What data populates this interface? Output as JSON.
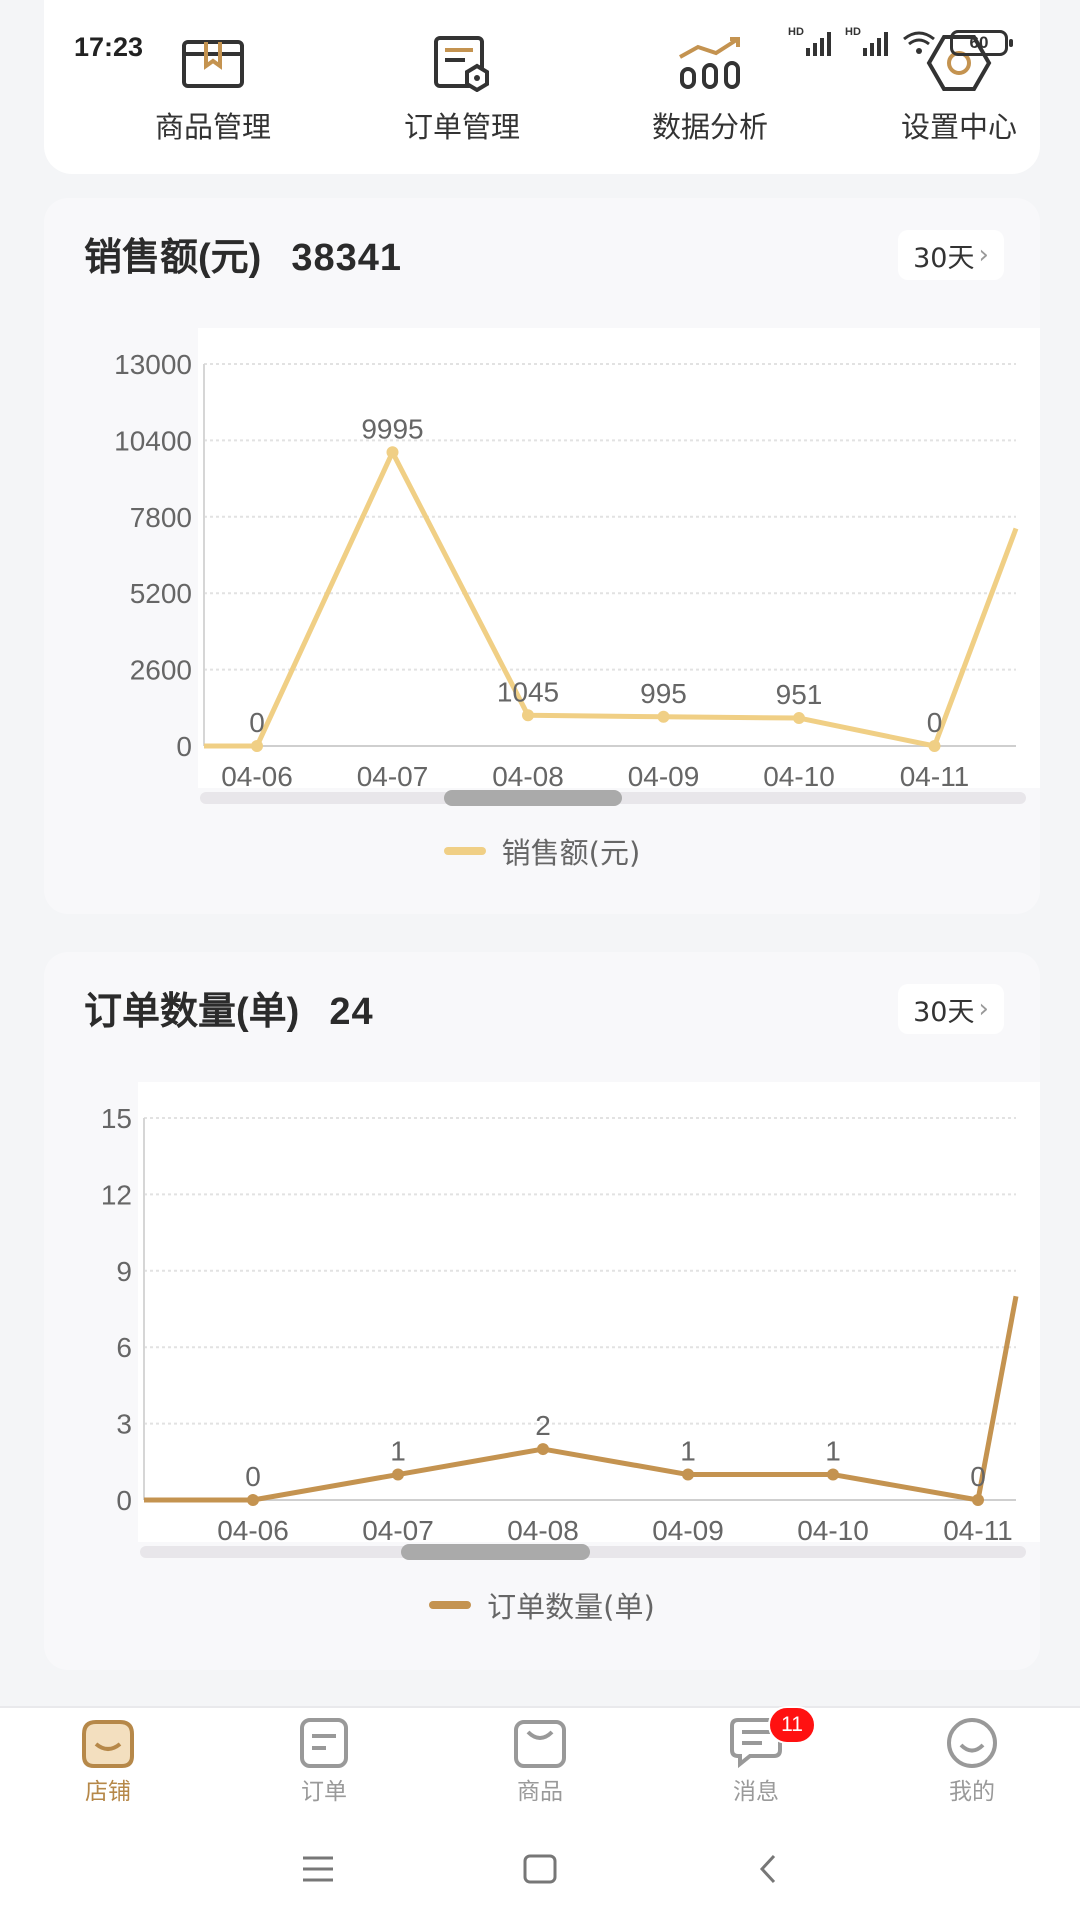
{
  "status": {
    "time": "17:23",
    "battery": "60"
  },
  "menu": [
    {
      "label": "商品管理",
      "icon": "product-box-icon"
    },
    {
      "label": "订单管理",
      "icon": "order-doc-icon"
    },
    {
      "label": "数据分析",
      "icon": "data-chart-icon"
    },
    {
      "label": "设置中心",
      "icon": "settings-gear-icon"
    }
  ],
  "sales": {
    "title": "销售额(元)",
    "total": "38341",
    "range": "30天",
    "legend": "销售额(元)",
    "color": "#f0cf85"
  },
  "orders": {
    "title": "订单数量(单)",
    "total": "24",
    "range": "30天",
    "legend": "订单数量(单)",
    "color": "#c49350"
  },
  "chart_data": [
    {
      "type": "line",
      "title": "销售额(元)",
      "categories": [
        "04-06",
        "04-07",
        "04-08",
        "04-09",
        "04-10",
        "04-11"
      ],
      "series": [
        {
          "name": "销售额(元)",
          "values": [
            0,
            9995,
            1045,
            995,
            951,
            0
          ]
        }
      ],
      "y_ticks": [
        0,
        2600,
        5200,
        7800,
        10400,
        13000
      ],
      "ylim": [
        0,
        13000
      ],
      "grid": true,
      "legend": "bottom-center"
    },
    {
      "type": "line",
      "title": "订单数量(单)",
      "categories": [
        "04-06",
        "04-07",
        "04-08",
        "04-09",
        "04-10",
        "04-11"
      ],
      "series": [
        {
          "name": "订单数量(单)",
          "values": [
            0,
            1,
            2,
            1,
            1,
            0
          ]
        }
      ],
      "y_ticks": [
        0,
        3,
        6,
        9,
        12,
        15
      ],
      "ylim": [
        0,
        15
      ],
      "grid": true,
      "legend": "bottom-center"
    }
  ],
  "tabs": [
    {
      "label": "店铺",
      "icon": "shop-icon",
      "active": true
    },
    {
      "label": "订单",
      "icon": "order-icon"
    },
    {
      "label": "商品",
      "icon": "product-bag-icon"
    },
    {
      "label": "消息",
      "icon": "message-icon",
      "badge": "11"
    },
    {
      "label": "我的",
      "icon": "profile-smile-icon"
    }
  ]
}
